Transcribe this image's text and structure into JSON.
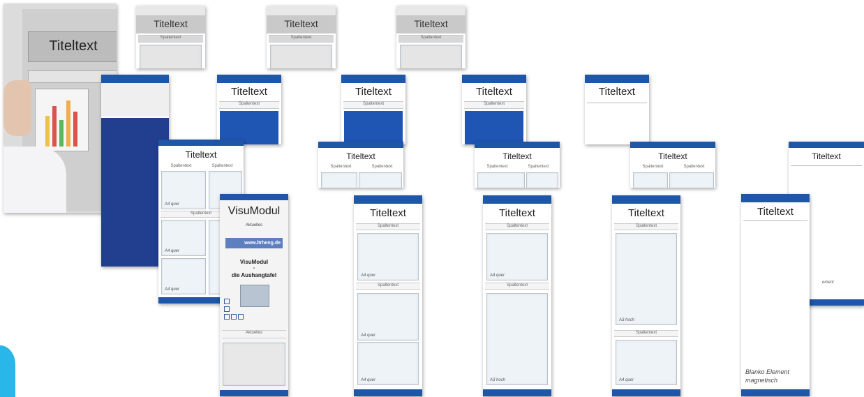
{
  "title": "Titeltext",
  "column": "Spaltentext",
  "brand": {
    "blue": "#1e56a8",
    "dark_blue": "#223f8f"
  },
  "visu": {
    "title": "VisuModul",
    "sub": "Aktuelles",
    "banner": "www.ltrheng.de",
    "line1": "VisuModul",
    "dash": "-",
    "line2": "die Aushangtafel",
    "footer": "Aktuelles"
  },
  "labels": {
    "a4": "A4 quer",
    "a3": "A3 hoch",
    "blank1": "Blanko Element",
    "blank2": "magnetisch",
    "ement": "ement"
  }
}
